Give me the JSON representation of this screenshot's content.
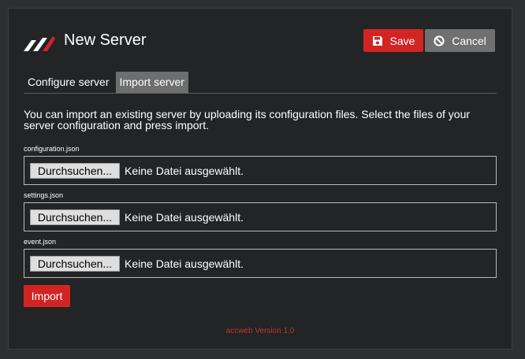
{
  "header": {
    "title": "New Server",
    "save_label": "Save",
    "cancel_label": "Cancel",
    "save_icon": "floppy-disk-icon",
    "cancel_icon": "ban-icon",
    "logo": "acc-logo"
  },
  "tabs": [
    {
      "label": "Configure server",
      "active": false
    },
    {
      "label": "Import server",
      "active": true
    }
  ],
  "intro_text": "You can import an existing server by uploading its configuration files. Select the files of your server configuration and press import.",
  "files": [
    {
      "label": "configuration.json",
      "browse_label": "Durchsuchen...",
      "status": "Keine Datei ausgewählt."
    },
    {
      "label": "settings.json",
      "browse_label": "Durchsuchen...",
      "status": "Keine Datei ausgewählt."
    },
    {
      "label": "event.json",
      "browse_label": "Durchsuchen...",
      "status": "Keine Datei ausgewählt."
    }
  ],
  "import_label": "Import",
  "footer": {
    "version": "accweb Version 1.0"
  },
  "colors": {
    "accent": "#d32424",
    "secondary": "#707070",
    "panel": "#222426",
    "background": "#2c3033"
  }
}
